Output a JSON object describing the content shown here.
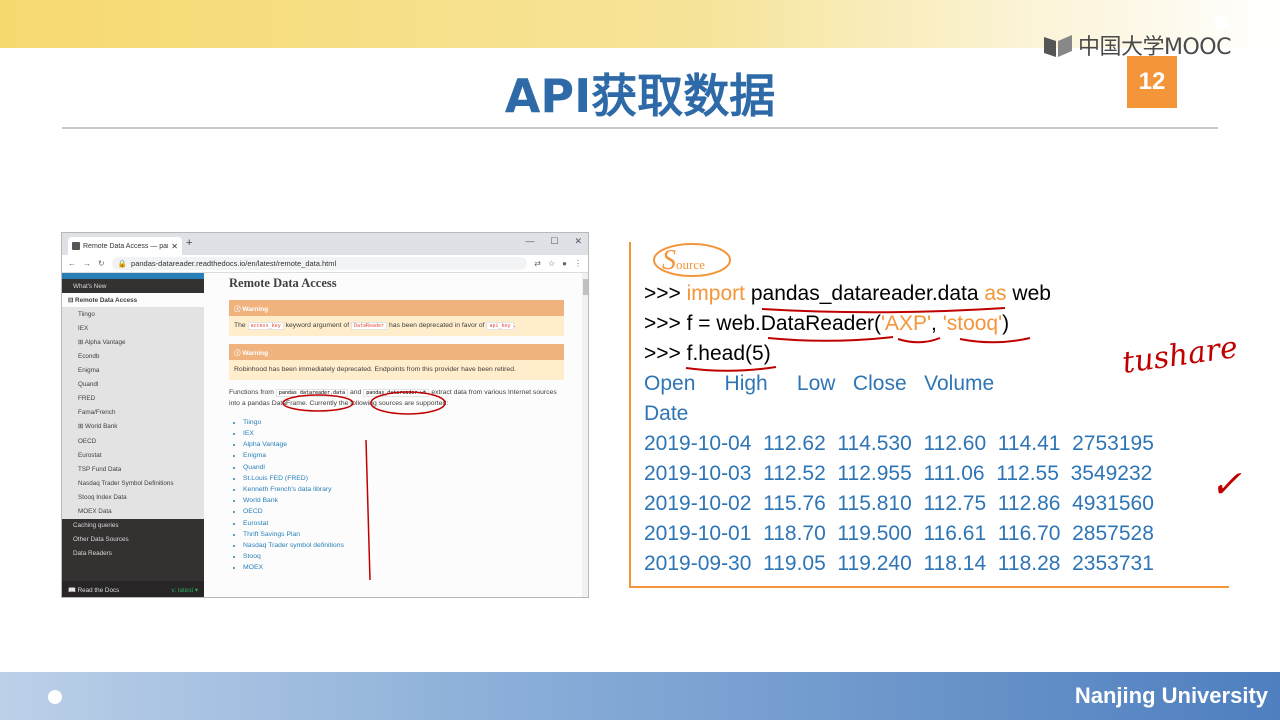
{
  "slide": {
    "title": "API获取数据",
    "page_number": "12",
    "logo_text": "中国大学MOOC",
    "footer": "Nanjing University"
  },
  "browser": {
    "tab_title": "Remote Data Access — pand...",
    "url": "pandas-datareader.readthedocs.io/en/latest/remote_data.html",
    "sidebar_items": [
      {
        "label": "What's New",
        "style": "dark"
      },
      {
        "label": "⊟ Remote Data Access",
        "style": "active"
      },
      {
        "label": "Tiingo",
        "style": "sub"
      },
      {
        "label": "IEX",
        "style": "sub"
      },
      {
        "label": "⊞ Alpha Vantage",
        "style": "sub"
      },
      {
        "label": "Econdb",
        "style": "sub"
      },
      {
        "label": "Enigma",
        "style": "sub"
      },
      {
        "label": "Quandl",
        "style": "sub"
      },
      {
        "label": "FRED",
        "style": "sub"
      },
      {
        "label": "Fama/French",
        "style": "sub"
      },
      {
        "label": "⊞ World Bank",
        "style": "sub"
      },
      {
        "label": "OECD",
        "style": "sub"
      },
      {
        "label": "Eurostat",
        "style": "sub"
      },
      {
        "label": "TSP Fund Data",
        "style": "sub"
      },
      {
        "label": "Nasdaq Trader Symbol Definitions",
        "style": "sub"
      },
      {
        "label": "Stooq Index Data",
        "style": "sub"
      },
      {
        "label": "MOEX Data",
        "style": "sub"
      },
      {
        "label": "Caching queries",
        "style": "dark"
      },
      {
        "label": "Other Data Sources",
        "style": "dark"
      },
      {
        "label": "Data Readers",
        "style": "dark"
      }
    ],
    "sidebar_footer": {
      "label": "📖 Read the Docs",
      "version": "v: latest ▾"
    },
    "doc_title": "Remote Data Access",
    "warning_label": "Warning",
    "warning1": {
      "pre": "The",
      "code1": "access_key",
      "mid": "keyword argument of",
      "code2": "DataReader",
      "post": "has been deprecated in favor of",
      "code3": "api_key",
      "end": "."
    },
    "warning2_text": "Robinhood has been immediately deprecated. Endpoints from this provider have been retired.",
    "functions_para": {
      "pre": "Functions from",
      "code1": "pandas_datareader.data",
      "mid": "and",
      "code2": "pandas_datareader.wb",
      "post": "extract data from various Internet sources into a pandas DataFrame. Currently the following sources are supported:"
    },
    "sources": [
      "Tiingo",
      "IEX",
      "Alpha Vantage",
      "Enigma",
      "Quandl",
      "St.Louis FED (FRED)",
      "Kenneth French's data library",
      "World Bank",
      "OECD",
      "Eurostat",
      "Thrift Savings Plan",
      "Nasdaq Trader symbol definitions",
      "Stooq",
      "MOEX"
    ]
  },
  "code": {
    "source_label_big": "S",
    "source_label_small": "ource",
    "prompt": ">>> ",
    "line1": {
      "kw_import": "import",
      "module": " pandas_datareader.data ",
      "kw_as": "as",
      "alias": " web"
    },
    "line2": {
      "pre": "f = web.DataReader(",
      "arg1": "'AXP'",
      "sep": ", ",
      "arg2": "'stooq'",
      "post": ")"
    },
    "line3": "f.head(5)",
    "header": "Open     High     Low   Close   Volume",
    "index_label": "Date",
    "rows": [
      "2019-10-04  112.62  114.530  112.60  114.41  2753195",
      "2019-10-03  112.52  112.955  111.06  112.55  3549232",
      "2019-10-02  115.76  115.810  112.75  112.86  4931560",
      "2019-10-01  118.70  119.500  116.61  116.70  2857528",
      "2019-09-30  119.05  119.240  118.14  118.28  2353731"
    ]
  },
  "annotations": {
    "handwritten_note": "tushare",
    "check_mark": "✓"
  },
  "colors": {
    "title_blue": "#2f6aa8",
    "accent_orange": "#f5953a",
    "code_blue": "#2e75b6",
    "annotation_red": "#c00000"
  }
}
